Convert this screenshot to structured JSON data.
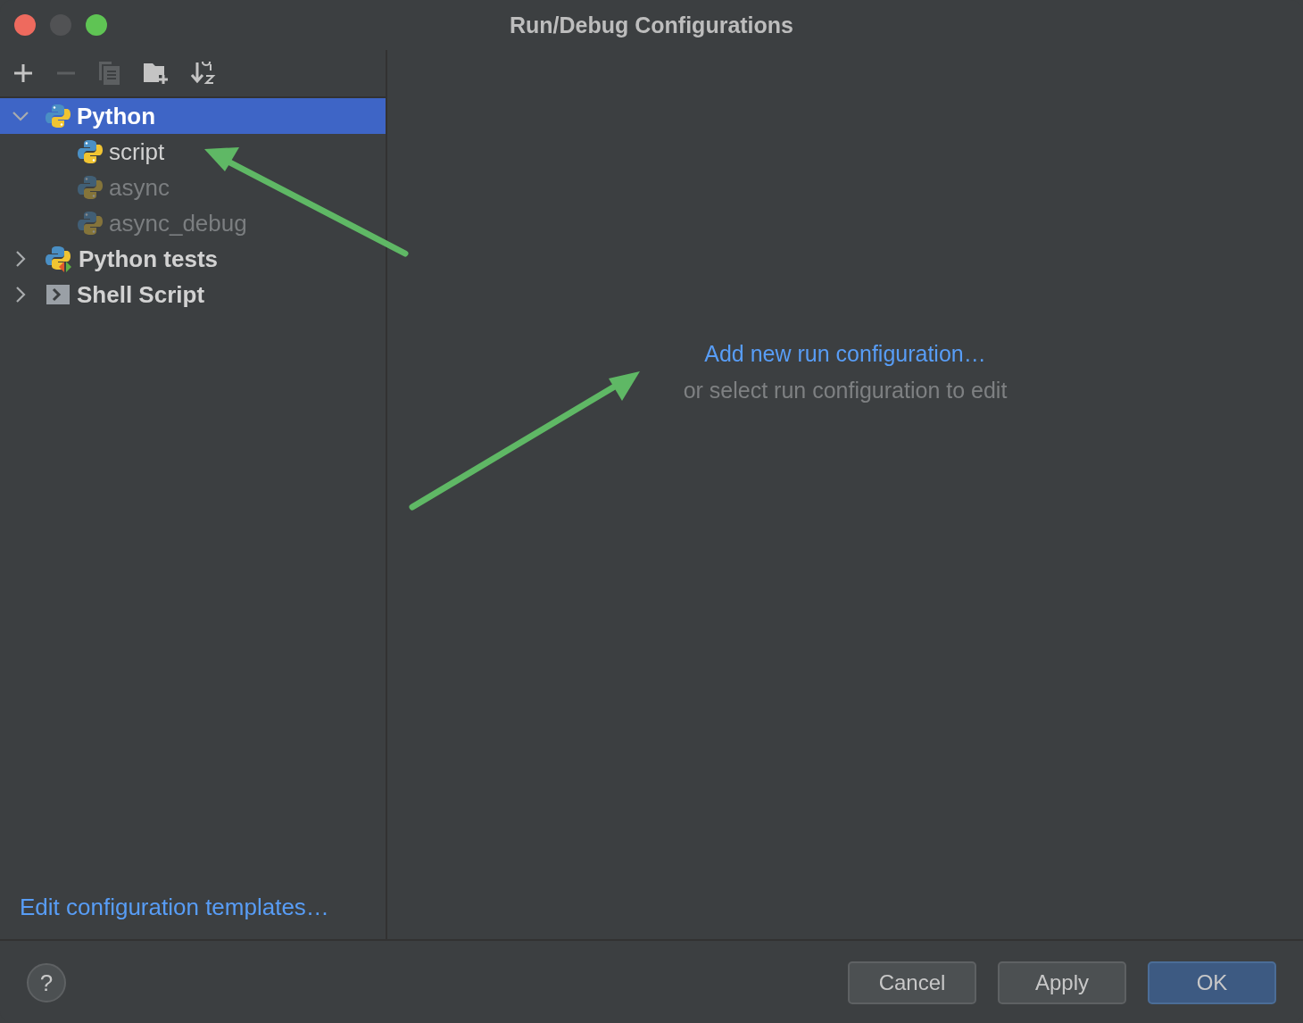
{
  "window": {
    "title": "Run/Debug Configurations"
  },
  "toolbar": [
    {
      "kind": "add",
      "disabled": false
    },
    {
      "kind": "remove",
      "disabled": true
    },
    {
      "kind": "copy",
      "disabled": true
    },
    {
      "kind": "folder",
      "disabled": false
    },
    {
      "kind": "sort",
      "disabled": false
    }
  ],
  "tree": [
    {
      "label": "Python",
      "kind": "python",
      "expanded": true,
      "selected": true,
      "disabled": false,
      "children": [
        {
          "label": "script",
          "kind": "python",
          "selected": false,
          "disabled": false
        },
        {
          "label": "async",
          "kind": "python",
          "selected": false,
          "disabled": true
        },
        {
          "label": "async_debug",
          "kind": "python",
          "selected": false,
          "disabled": true
        }
      ]
    },
    {
      "label": "Python tests",
      "kind": "python-tests",
      "expanded": false,
      "selected": false,
      "disabled": false
    },
    {
      "label": "Shell Script",
      "kind": "shell",
      "expanded": false,
      "selected": false,
      "disabled": false
    }
  ],
  "templates_link": "Edit configuration templates…",
  "empty_state": {
    "link": "Add new run configuration…",
    "hint": "or select run configuration to edit"
  },
  "help_button": "?",
  "buttons": [
    {
      "label": "Cancel",
      "default": false
    },
    {
      "label": "Apply",
      "default": false
    },
    {
      "label": "OK",
      "default": true
    }
  ]
}
